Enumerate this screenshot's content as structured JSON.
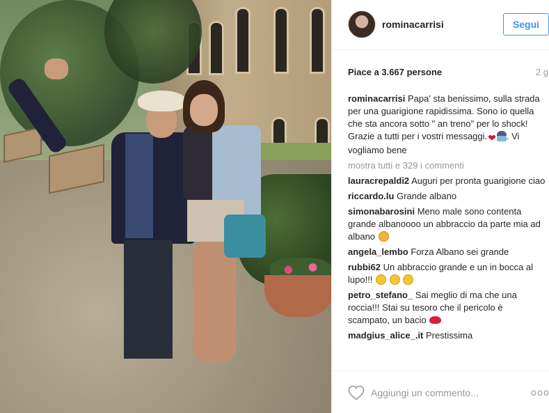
{
  "post": {
    "photo_alt": "",
    "username": "rominacarrisi",
    "follow_label": "Segui",
    "likes": "Piace a 3.667 persone",
    "time_ago": "2 g",
    "caption": {
      "user": "rominacarrisi",
      "text": "Papa' sta benissimo, sulla strada per una guarigione rapidissima. Sono io quella che sta ancora sotto \" an treno\" per lo shock! Grazie a tutti per i vostri messaggi.",
      "text_after": ". Vi vogliamo bene"
    },
    "show_all_comments": "mostra tutti e 329 i commenti",
    "comment_placeholder": "Aggiungi un commento...",
    "more_options": "ooo"
  },
  "comments": [
    {
      "user": "lauracrepaldi2",
      "text": "Auguri per pronta guarigione ciao"
    },
    {
      "user": "riccardo.lu",
      "text": "Grande albano"
    },
    {
      "user": "simonabarosini",
      "text": "Meno male sono contenta grande albanoooo un abbraccio da parte mia ad albano"
    },
    {
      "user": "angela_lembo",
      "text": "Forza Albano sei grande"
    },
    {
      "user": "rubbi62",
      "text": "Un abbraccio grande e un in bocca al lupo!!!"
    },
    {
      "user": "petro_stefano_",
      "text": "Sai meglio di ma che una roccia!!! Stai su tesoro che il pericolo è scampato, un bacio"
    },
    {
      "user": "madgius_alice_.it",
      "text": "Prestissima"
    }
  ],
  "icons": {
    "heart": "heart-icon",
    "more": "more-options-icon",
    "emoji_colors": {
      "smile": "#f7c531",
      "heart": "#d5152a"
    }
  },
  "colors": {
    "accent": "#3897f0",
    "text": "#262626",
    "muted": "#999999"
  }
}
